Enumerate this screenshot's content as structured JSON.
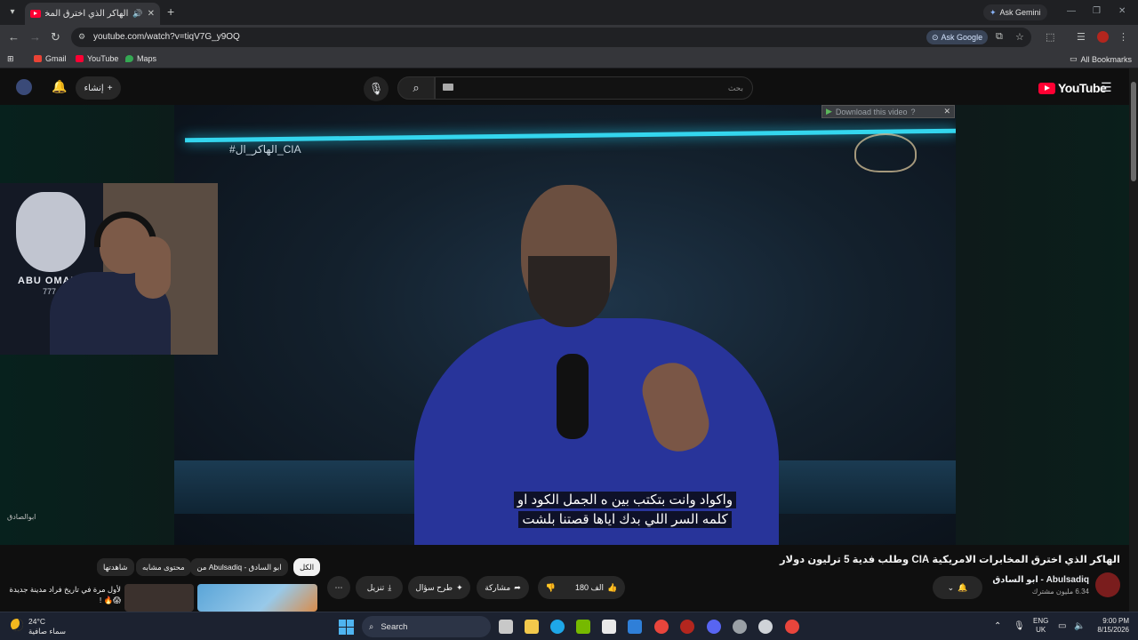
{
  "browser": {
    "tab_title": "الهاكر الذي اخترق المخابرات ال",
    "address": "youtube.com/watch?v=tiqV7G_y9OQ",
    "ask_gemini": "Ask Gemini",
    "ask_google": "Ask Google",
    "bookmarks": [
      "Gmail",
      "YouTube",
      "Maps"
    ],
    "all_bookmarks": "All Bookmarks"
  },
  "youtube": {
    "create_label": "إنشاء",
    "search_placeholder": "بحث",
    "logo_text": "YouTube",
    "download_bar": "Download this video",
    "video_hashtag": "#الهاكر_ال_CIA",
    "caption_line1": "واكواد وانت بتكتب بين ه الجمل الكود او",
    "caption_line2": "كلمه السر اللي بدك اياها قصتنا بلشت",
    "webcam_brand": "ABU OMAR",
    "webcam_brand_num": "777",
    "watermark": "ابوالصادق",
    "video_title": "الهاكر الذي اخترق المخابرات الامريكية CIA وطلب فدية 5 ترليون دولار",
    "channel_name": "Abulsadiq - ابو السادق",
    "channel_subs": "6.34 مليون مشترك",
    "likes": "180 الف",
    "share_label": "مشاركة",
    "ask_label": "طرح سؤال",
    "download_label": "تنزيل",
    "chips": [
      "الكل",
      "من Abulsadiq - ابو السادق",
      "محتوى مشابه",
      "شاهدتها"
    ],
    "rec_title": "لأول مرة في تاريخ فراد مدينة جديدة 😱🔥 !"
  },
  "taskbar": {
    "temperature": "24°C",
    "condition": "سماء صافية",
    "search_label": "Search",
    "lang_top": "ENG",
    "lang_bottom": "UK",
    "time": "9:00 PM",
    "date": "8/15/2026"
  },
  "colors": {
    "youtube_red": "#ff0033",
    "neon": "#34d6ee",
    "taskbar": "#1c2230"
  }
}
